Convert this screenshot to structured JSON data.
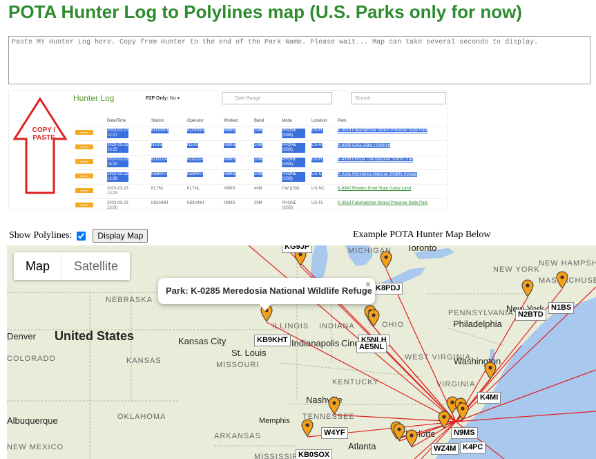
{
  "page_title": "POTA Hunter Log to Polylines map (U.S. Parks only for now)",
  "log_input": {
    "placeholder": "Paste MY Hunter Log here. Copy from Hunter to the end of the Park Name. Please wait... Map can take several seconds to display."
  },
  "sample_image": {
    "copy_paste": "COPY / PASTE",
    "heading": "Hunter Log",
    "p2p_label": "P2P Only:",
    "p2p_value": "No",
    "date_range": "Date Range",
    "search": "Search",
    "columns": [
      "Date/Time",
      "Station",
      "Operator",
      "Worked",
      "Band",
      "Mode",
      "Location",
      "Park"
    ],
    "rows": [
      {
        "tag": "Hunter",
        "date": "2023-03-27",
        "time": "12:27",
        "station": "KD1NNI1",
        "operator": "KD1NNI1",
        "worked": "N9MS",
        "band": "20M",
        "mode": "PHONE (SSB)",
        "location": "US-FL",
        "park": "K-3618 Fakahatchee Strand Preserve State Park",
        "selected": true
      },
      {
        "tag": "Hunter",
        "date": "2023-03-23",
        "time": "16:25",
        "station": "N1RS",
        "operator": "N1RS",
        "worked": "N9MS",
        "band": "20M",
        "mode": "PHONE (SSB)",
        "location": "US-RI",
        "park": "K-6988 Colts State Preserve",
        "selected": true
      },
      {
        "tag": "Hunter",
        "date": "2023-03-23",
        "time": "16:20",
        "station": "KD2ZZA",
        "operator": "KD2ZZA",
        "worked": "N9MS",
        "band": "20M",
        "mode": "PHONE (SSB)",
        "location": "US-FL",
        "park": "K-4539 Florida Trail National Scenic Trail",
        "selected": true
      },
      {
        "tag": "Hunter",
        "date": "2023-03-23",
        "time": "13:39",
        "station": "KB9KHT",
        "operator": "KB9KHT",
        "worked": "N9MS",
        "band": "20M",
        "mode": "PHONE (SSB)",
        "location": "US-IL",
        "park": "K-0285 Meredosia National Wildlife Refuge",
        "selected": true
      },
      {
        "tag": "Hunter",
        "date": "2023-03-23",
        "time": "13:23",
        "station": "KL7NL",
        "operator": "KL7NL",
        "worked": "N9MS",
        "band": "40M",
        "mode": "CW (CW)",
        "location": "US-NC",
        "park": "K-6942 Rhodes Pond State Game Land",
        "selected": false
      },
      {
        "tag": "Hunter",
        "date": "2023-03-23",
        "time": "13:00",
        "station": "KB1NNH",
        "operator": "KB1NNH",
        "worked": "N9MS",
        "band": "20M",
        "mode": "PHONE (SSB)",
        "location": "US-FL",
        "park": "K-3618 Fakahatchee Strand Preserve State Park",
        "selected": false
      }
    ]
  },
  "controls": {
    "show_polylines_label": "Show Polylines:",
    "show_polylines_checked": true,
    "display_map_button": "Display Map",
    "example_caption": "Example POTA Hunter Map Below"
  },
  "map": {
    "type_control": {
      "map": "Map",
      "satellite": "Satellite",
      "selected": "Map"
    },
    "popup": "Park: K-0285 Meredosia National Wildlife Refuge",
    "popup_close": "×",
    "callsigns": [
      "KG9JP",
      "K8PDJ",
      "N2BTD",
      "N1BS",
      "KB9KHT",
      "K5NLH",
      "AE5NL",
      "K4MI",
      "W4YF",
      "N9MS",
      "KB0SOX",
      "WZ4M",
      "K4PC"
    ],
    "places": {
      "cities": [
        "Toronto",
        "Kansas City",
        "St. Louis",
        "Indianapolis",
        "Cincinnati",
        "Nashville",
        "Memphis",
        "Charlotte",
        "Atlanta",
        "Philadelphia",
        "Washington",
        "New York",
        "Denver",
        "Albuquerque"
      ],
      "states": [
        "MICHIGAN",
        "NEW YORK",
        "NEW HAMPSHIRE",
        "MASSACHUSETTS",
        "NEBRASKA",
        "ILLINOIS",
        "INDIANA",
        "OHIO",
        "PENNSYLVANIA",
        "WEST VIRGINIA",
        "VIRGINIA",
        "KENTUCKY",
        "TENNESSEE",
        "KANSAS",
        "MISSOURI",
        "OKLAHOMA",
        "ARKANSAS",
        "COLORADO",
        "NEW MEXICO",
        "MISSISSIPPI"
      ],
      "country": "United States"
    },
    "colors": {
      "polyline": "#e0201e",
      "marker": "#f5a01a",
      "land": "#e9ecd9",
      "water": "#a9c8ee"
    }
  }
}
